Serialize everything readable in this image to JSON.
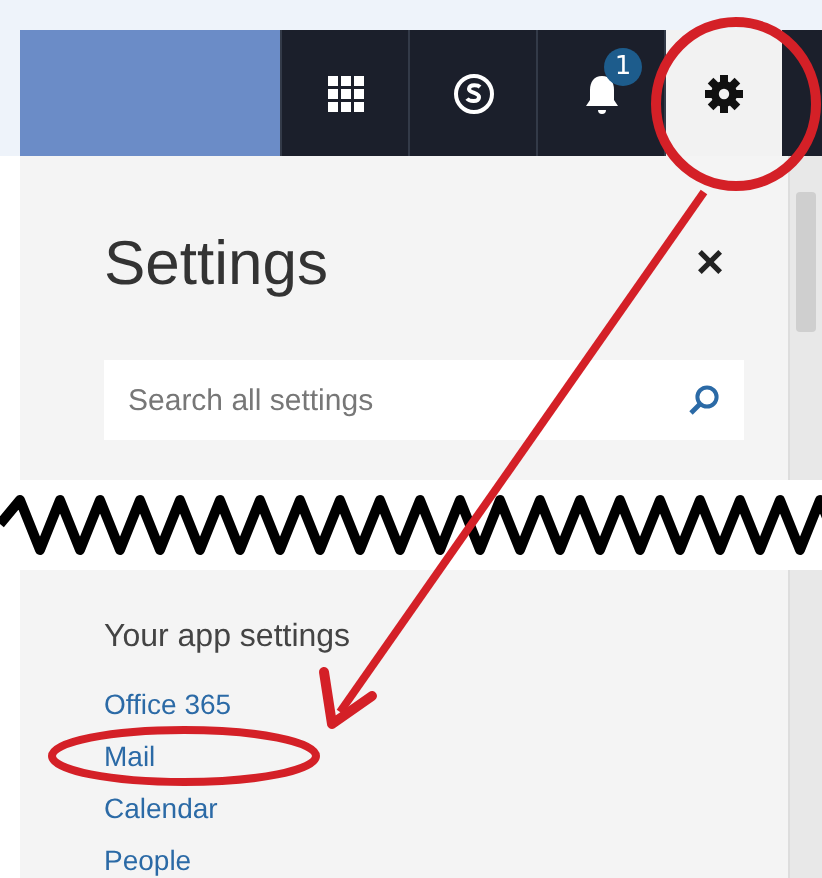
{
  "top_bar": {
    "notification_count": "1"
  },
  "settings_panel": {
    "title": "Settings",
    "close": "×",
    "search": {
      "placeholder": "Search all settings"
    },
    "section_title": "Your app settings",
    "items": [
      {
        "label": "Office 365"
      },
      {
        "label": "Mail"
      },
      {
        "label": "Calendar"
      },
      {
        "label": "People"
      }
    ]
  }
}
